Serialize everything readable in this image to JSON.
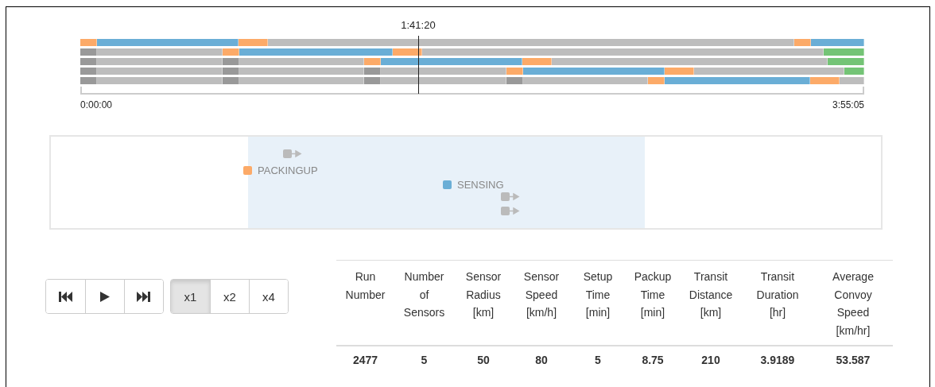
{
  "timeline": {
    "cursor": {
      "label": "1:41:20",
      "level": 0.431
    },
    "start_label": "0:00:00",
    "end_label": "3:55:05",
    "rows": [
      {
        "segments": [
          {
            "kind": "packingup"
          },
          {
            "kind": "sensing"
          },
          {
            "kind": "packingup"
          },
          {
            "kind": "idle"
          },
          {
            "kind": "packingup"
          },
          {
            "kind": "sensing"
          }
        ]
      },
      {
        "segments": [
          {
            "kind": "parked"
          },
          {
            "kind": "idle"
          },
          {
            "kind": "packingup"
          },
          {
            "kind": "sensing"
          },
          {
            "kind": "packingup"
          },
          {
            "kind": "idle"
          },
          {
            "kind": "finished"
          }
        ]
      },
      {
        "segments": [
          {
            "kind": "parked"
          },
          {
            "kind": "idle"
          },
          {
            "kind": "parked"
          },
          {
            "kind": "idle"
          },
          {
            "kind": "packingup"
          },
          {
            "kind": "sensing"
          },
          {
            "kind": "packingup"
          },
          {
            "kind": "idle"
          },
          {
            "kind": "finished"
          }
        ]
      },
      {
        "segments": [
          {
            "kind": "parked"
          },
          {
            "kind": "idle"
          },
          {
            "kind": "parked"
          },
          {
            "kind": "idle"
          },
          {
            "kind": "parked"
          },
          {
            "kind": "idle"
          },
          {
            "kind": "packingup"
          },
          {
            "kind": "sensing"
          },
          {
            "kind": "packingup"
          },
          {
            "kind": "idle"
          },
          {
            "kind": "finished"
          }
        ]
      },
      {
        "segments": [
          {
            "kind": "parked"
          },
          {
            "kind": "idle"
          },
          {
            "kind": "parked"
          },
          {
            "kind": "idle"
          },
          {
            "kind": "parked"
          },
          {
            "kind": "idle"
          },
          {
            "kind": "parked"
          },
          {
            "kind": "idle"
          },
          {
            "kind": "packingup"
          },
          {
            "kind": "sensing"
          },
          {
            "kind": "packingup"
          },
          {
            "kind": "idle"
          }
        ]
      }
    ]
  },
  "map": {
    "items": [
      {
        "kind": "vehicle"
      },
      {
        "kind": "marker",
        "label": "PACKINGUP",
        "color": "#fcaa68"
      },
      {
        "kind": "marker",
        "label": "SENSING",
        "color": "#6aaed6"
      },
      {
        "kind": "vehicle"
      },
      {
        "kind": "vehicle"
      }
    ]
  },
  "playback": {
    "buttons": [
      {
        "kind": "skip-back"
      },
      {
        "kind": "play"
      },
      {
        "kind": "skip-forward"
      }
    ]
  },
  "speed": [
    {
      "label": "x1",
      "selected": true
    },
    {
      "label": "x2",
      "selected": false
    },
    {
      "label": "x4",
      "selected": false
    }
  ],
  "table": {
    "columns": [
      "Run Number",
      "Number of Sensors",
      "Sensor Radius [km]",
      "Sensor Speed [km/h]",
      "Setup Time [min]",
      "Packup Time [min]",
      "Transit Distance [km]",
      "Transit Duration [hr]",
      "Average Convoy Speed [km/hr]"
    ],
    "rows": [
      [
        "2477",
        "5",
        "50",
        "80",
        "5",
        "8.75",
        "210",
        "3.9189",
        "53.587"
      ]
    ]
  }
}
